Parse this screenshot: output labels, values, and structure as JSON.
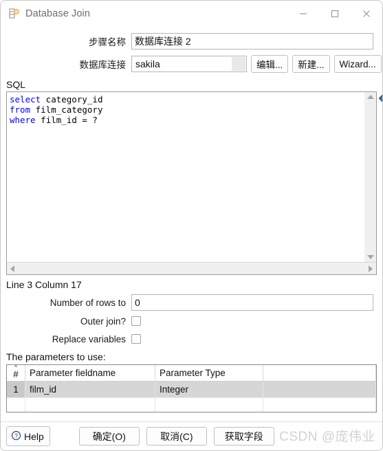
{
  "window": {
    "title": "Database Join",
    "icon": "database-join-icon",
    "controls": {
      "minimize": "minimize-icon",
      "maximize": "maximize-icon",
      "close": "close-icon"
    }
  },
  "form": {
    "step_name_label": "步骤名称",
    "step_name_value": "数据库连接 2",
    "connection_label": "数据库连接",
    "connection_value": "sakila",
    "edit_button": "编辑...",
    "new_button": "新建...",
    "wizard_button": "Wizard..."
  },
  "sql": {
    "section_label": "SQL",
    "lines": [
      {
        "keyword": "select",
        "rest": " category_id"
      },
      {
        "keyword": "from",
        "rest": " film_category"
      },
      {
        "keyword": "where",
        "rest": " film_id = ?"
      }
    ],
    "keyword_color": "#0000ff",
    "marker_icon": "bookmark-diamond-icon",
    "status": "Line 3 Column 17"
  },
  "options": {
    "rows_label": "Number of rows to",
    "rows_value": "0",
    "outer_join_label": "Outer join?",
    "outer_join_checked": false,
    "replace_variables_label": "Replace variables",
    "replace_variables_checked": false
  },
  "parameters": {
    "caption": "The parameters to use:",
    "columns": [
      "#",
      "Parameter fieldname",
      "Parameter Type"
    ],
    "rows": [
      {
        "num": "1",
        "fieldname": "film_id",
        "type": "Integer",
        "selected": true
      },
      {
        "num": "",
        "fieldname": "",
        "type": "",
        "selected": false
      }
    ]
  },
  "footer": {
    "help_label": "Help",
    "help_icon": "question-circle-icon",
    "ok_label": "确定(O)",
    "cancel_label": "取消(C)",
    "get_fields_label": "获取字段",
    "watermark": "CSDN @庞伟业"
  }
}
